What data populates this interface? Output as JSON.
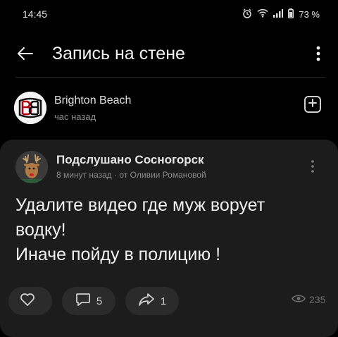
{
  "status_bar": {
    "time": "14:45",
    "battery": "73 %",
    "icons": [
      "alarm-icon",
      "wifi-icon",
      "signal-icon",
      "battery-icon"
    ]
  },
  "app_bar": {
    "title": "Запись на стене",
    "back_icon": "arrow-left-icon",
    "more_icon": "more-vertical-icon"
  },
  "repost": {
    "group_name": "Brighton Beach",
    "time": "час назад",
    "add_icon": "add-square-icon"
  },
  "post": {
    "author": "Подслушано Сосногорск",
    "meta": "8 минут назад · от Оливии Романовой",
    "text_lines": [
      "Удалите видео где муж ворует",
      "водку!",
      "Иначе пойду в полицию !"
    ],
    "actions": {
      "likes": "",
      "comments": "5",
      "shares": "1",
      "views": "235"
    }
  },
  "colors": {
    "background": "#000000",
    "card": "#1c1c1c",
    "pill": "#2b2b2b",
    "text_primary": "#f0f0f0",
    "text_secondary": "#8a8a8a"
  }
}
